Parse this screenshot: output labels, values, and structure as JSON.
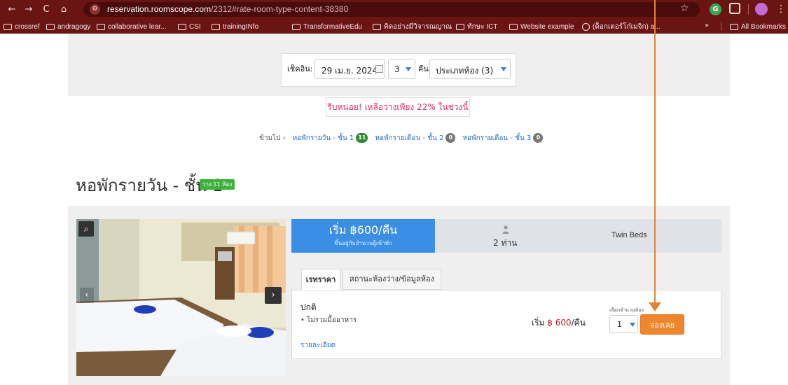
{
  "browser": {
    "url_host": "reservation.roomscope.com",
    "url_path": "/2312#rate-room-type-content-38380",
    "bookmarks": [
      {
        "label": "crossref"
      },
      {
        "label": "andragogy"
      },
      {
        "label": "collaborative lear..."
      },
      {
        "label": "CSI"
      },
      {
        "label": "trainingINfo"
      },
      {
        "label": "TransformativeEdu"
      },
      {
        "label": "คิดอย่างมีวิจารณญาณ"
      },
      {
        "label": "ทักษะ ICT"
      },
      {
        "label": "Website example"
      },
      {
        "label": "(ด็อกเตอร์โก๋เมจิก) a..."
      }
    ],
    "more_label": "»",
    "all_bookmarks": "All Bookmarks"
  },
  "search": {
    "checkin_label": "เช็คอิน:",
    "checkin_date": "29 เม.ย. 2024",
    "nights_value": "3",
    "nights_label": "คืน",
    "room_type": "ประเภทห้อง (3)"
  },
  "notice": {
    "hurry": "รีบหน่อย! เหลือว่างเพียง 22% ในช่วงนี้"
  },
  "jump": {
    "label": "ข้ามไป ›",
    "links": [
      {
        "label": "หอพักรายวัน - ชั้น 1",
        "count": "11",
        "color": "#2e8b2e"
      },
      {
        "label": "หอพักรายเดือน - ชั้น 2",
        "count": "0",
        "color": "#777777"
      },
      {
        "label": "หอพักรายเดือน - ชั้น 3",
        "count": "0",
        "color": "#777777"
      }
    ]
  },
  "room": {
    "title": "หอพักรายวัน - ชั้น 1",
    "badge": "ว่าง 11 ห้อง",
    "price_main": "เริ่ม ฿600/คืน",
    "price_sub": "ขึ้นอยู่กับจำนวนผู้เข้าพัก",
    "guests": "2 ท่าน",
    "beds": "Twin Beds",
    "tabs": {
      "rate": "เรทราคา",
      "availability": "สถานะห้องว่าง/ข้อมูลห้อง"
    },
    "plan": {
      "name": "ปกติ",
      "feature": "• ไม่รวมมื้ออาหาร",
      "details_link": "รายละเอียด",
      "from_prefix": "เริ่ม ",
      "amount": "฿ 600",
      "per_night": "/คืน",
      "qty_label": "เลือกจำนวนห้อง",
      "qty_value": "1",
      "book_label": "จองเลย"
    }
  },
  "colors": {
    "accent_blue": "#3a8ee6",
    "book_orange": "#f0862b",
    "browser_frame": "#6b1414",
    "annotation_arrow": "#e58332"
  }
}
